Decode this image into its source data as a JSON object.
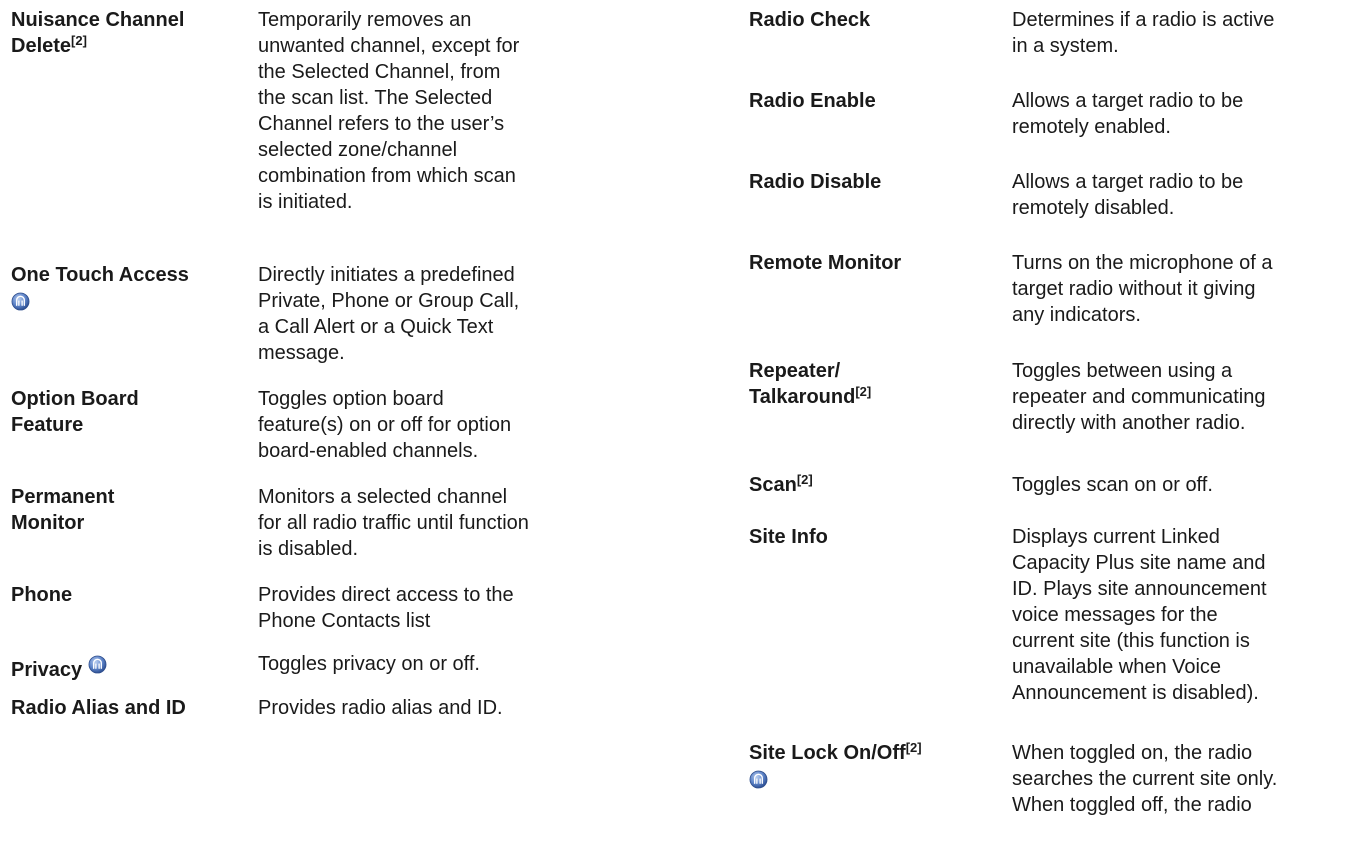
{
  "left_column": [
    {
      "term": [
        "Nuisance Channel",
        "Delete"
      ],
      "sup": "[2]",
      "icon": null,
      "desc": [
        "Temporarily removes an",
        "unwanted channel, except for",
        "the Selected Channel, from",
        "the scan list. The Selected",
        "Channel refers to the user’s",
        "selected zone/channel",
        "combination from which scan",
        "is initiated."
      ]
    },
    {
      "term": [
        "One Touch Access"
      ],
      "sup": null,
      "icon": "premium-feature-icon",
      "desc": [
        "Directly initiates a predefined",
        "Private, Phone or Group Call,",
        "a Call Alert or a Quick Text",
        "message."
      ]
    },
    {
      "term": [
        "Option Board",
        "Feature"
      ],
      "sup": null,
      "icon": null,
      "desc": [
        "Toggles option board",
        "feature(s) on or off for option",
        "board-enabled channels."
      ]
    },
    {
      "term": [
        "Permanent",
        "Monitor"
      ],
      "sup": null,
      "icon": null,
      "desc": [
        "Monitors a selected channel",
        "for all radio traffic until function",
        "is disabled."
      ]
    },
    {
      "term": [
        "Phone"
      ],
      "sup": null,
      "icon": null,
      "desc": [
        "Provides direct access to the",
        "Phone Contacts list"
      ]
    },
    {
      "term": [
        "Privacy"
      ],
      "sup": null,
      "icon": "premium-feature-icon",
      "desc": [
        "Toggles privacy on or off."
      ]
    },
    {
      "term": [
        "Radio Alias and ID"
      ],
      "sup": null,
      "icon": null,
      "desc": [
        "Provides radio alias and ID."
      ]
    }
  ],
  "right_column": [
    {
      "term": [
        "Radio Check"
      ],
      "sup": null,
      "icon": null,
      "desc": [
        "Determines if a radio is active",
        "in a system."
      ]
    },
    {
      "term": [
        "Radio Enable"
      ],
      "sup": null,
      "icon": null,
      "desc": [
        "Allows a target radio to be",
        "remotely enabled."
      ]
    },
    {
      "term": [
        "Radio Disable"
      ],
      "sup": null,
      "icon": null,
      "desc": [
        "Allows a target radio to be",
        "remotely disabled."
      ]
    },
    {
      "term": [
        "Remote Monitor"
      ],
      "sup": null,
      "icon": null,
      "desc": [
        "Turns on the microphone of a",
        "target radio without it giving",
        "any indicators."
      ]
    },
    {
      "term": [
        "Repeater/",
        "Talkaround"
      ],
      "sup": "[2]",
      "icon": null,
      "desc": [
        "Toggles between using a",
        "repeater and communicating",
        "directly with another radio."
      ]
    },
    {
      "term": [
        "Scan"
      ],
      "sup": "[2]",
      "icon": null,
      "desc": [
        "Toggles scan on or off."
      ]
    },
    {
      "term": [
        "Site Info"
      ],
      "sup": null,
      "icon": null,
      "desc": [
        "Displays current Linked",
        "Capacity Plus site name and",
        "ID. Plays site announcement",
        "voice messages for the",
        "current site (this function is",
        "unavailable when Voice",
        "Announcement is disabled)."
      ]
    },
    {
      "term": [
        "Site Lock On/Off"
      ],
      "sup": "[2]",
      "icon": "premium-feature-icon",
      "desc": [
        "When toggled on, the radio",
        "searches the current site only.",
        "When toggled off, the radio"
      ]
    }
  ]
}
